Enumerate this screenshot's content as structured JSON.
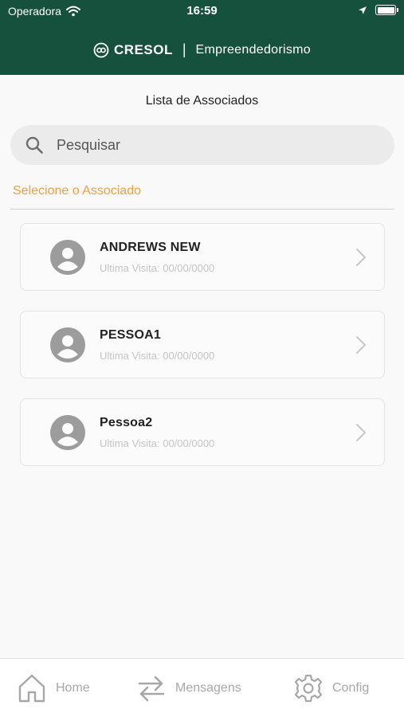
{
  "status_bar": {
    "carrier": "Operadora",
    "time": "16:59"
  },
  "header": {
    "brand": "CRESOL",
    "separator": "|",
    "subtitle": "Empreendedorismo"
  },
  "page": {
    "title": "Lista de Associados"
  },
  "search": {
    "placeholder": "Pesquisar",
    "value": ""
  },
  "section": {
    "label": "Selecione o Associado"
  },
  "associates": [
    {
      "name": "ANDREWS NEW",
      "last_visit": "Ultima Visita: 00/00/0000"
    },
    {
      "name": "PESSOA1",
      "last_visit": "Ultima Visita: 00/00/0000"
    },
    {
      "name": "Pessoa2",
      "last_visit": "Ultima Visita: 00/00/0000"
    }
  ],
  "tabs": [
    {
      "label": "Home",
      "icon": "home-icon"
    },
    {
      "label": "Mensagens",
      "icon": "swap-arrows-icon"
    },
    {
      "label": "Config",
      "icon": "gear-icon"
    }
  ],
  "colors": {
    "header_bg": "#16513e",
    "accent": "#f2a03d",
    "inactive_tab": "#a7a7a7"
  }
}
